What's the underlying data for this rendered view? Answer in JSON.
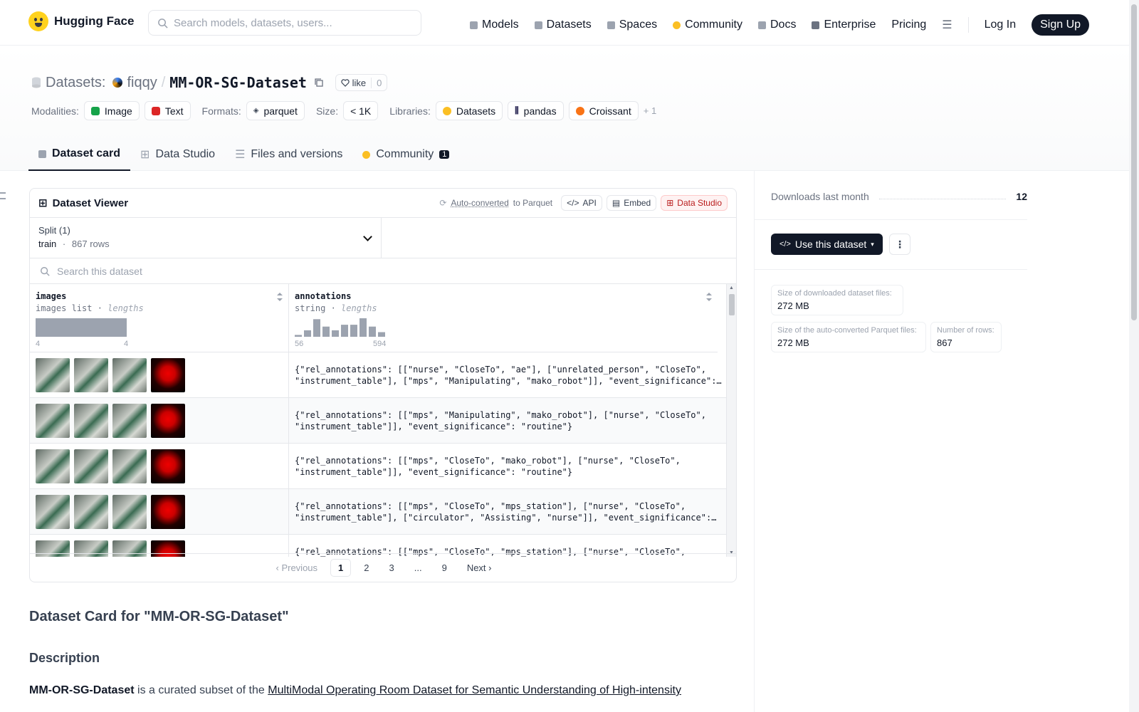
{
  "header": {
    "brand": "Hugging Face",
    "search_placeholder": "Search models, datasets, users...",
    "nav": [
      {
        "label": "Models",
        "icon": "cube-icon",
        "color": "#9ca3af"
      },
      {
        "label": "Datasets",
        "icon": "database-icon",
        "color": "#9ca3af"
      },
      {
        "label": "Spaces",
        "icon": "grid-icon",
        "color": "#9ca3af"
      },
      {
        "label": "Community",
        "icon": "community-icon",
        "color": "#fbbf24"
      },
      {
        "label": "Docs",
        "icon": "book-icon",
        "color": "#9ca3af"
      },
      {
        "label": "Enterprise",
        "icon": "enterprise-icon",
        "color": "#6b7280"
      },
      {
        "label": "Pricing",
        "icon": "",
        "color": ""
      }
    ],
    "login": "Log In",
    "signup": "Sign Up"
  },
  "repo": {
    "type_label": "Datasets:",
    "owner": "fiqqy",
    "slash": "/",
    "name": "MM-OR-SG-Dataset",
    "like_label": "like",
    "like_count": "0"
  },
  "tags": {
    "modalities_label": "Modalities:",
    "modalities": [
      "Image",
      "Text"
    ],
    "formats_label": "Formats:",
    "formats": [
      "parquet"
    ],
    "size_label": "Size:",
    "size": "< 1K",
    "libraries_label": "Libraries:",
    "libraries": [
      "Datasets",
      "pandas",
      "Croissant"
    ],
    "more": "+ 1"
  },
  "tabs": [
    {
      "label": "Dataset card",
      "active": true
    },
    {
      "label": "Data Studio",
      "active": false
    },
    {
      "label": "Files and versions",
      "active": false
    },
    {
      "label": "Community",
      "active": false,
      "count": "1"
    }
  ],
  "viewer": {
    "title": "Dataset Viewer",
    "auto_converted": "Auto-converted",
    "to_parquet": "to Parquet",
    "api": "API",
    "embed": "Embed",
    "data_studio": "Data Studio",
    "split_label": "Split (1)",
    "split_name": "train",
    "split_dot": "·",
    "split_rows": "867 rows",
    "search_placeholder": "Search this dataset",
    "columns": [
      {
        "name": "images",
        "type": "images list",
        "stat": "lengths",
        "min": "4",
        "max": "4",
        "hist": [
          1.0
        ]
      },
      {
        "name": "annotations",
        "type": "string",
        "stat": "lengths",
        "min": "56",
        "max": "594",
        "hist": [
          0.1,
          0.35,
          0.95,
          0.55,
          0.35,
          0.65,
          0.65,
          1.0,
          0.55,
          0.25
        ]
      }
    ],
    "rows": [
      {
        "text": "{\"rel_annotations\": [[\"nurse\", \"CloseTo\", \"ae\"], [\"unrelated_person\", \"CloseTo\",\n\"instrument_table\"], [\"mps\", \"Manipulating\", \"mako_robot\"]], \"event_significance\":…"
      },
      {
        "text": "{\"rel_annotations\": [[\"mps\", \"Manipulating\", \"mako_robot\"], [\"nurse\", \"CloseTo\",\n\"instrument_table\"]], \"event_significance\": \"routine\"}"
      },
      {
        "text": "{\"rel_annotations\": [[\"mps\", \"CloseTo\", \"mako_robot\"], [\"nurse\", \"CloseTo\",\n\"instrument_table\"]], \"event_significance\": \"routine\"}"
      },
      {
        "text": "{\"rel_annotations\": [[\"mps\", \"CloseTo\", \"mps_station\"], [\"nurse\", \"CloseTo\",\n\"instrument_table\"], [\"circulator\", \"Assisting\", \"nurse\"]], \"event_significance\":…"
      },
      {
        "text": "{\"rel_annotations\": [[\"mps\", \"CloseTo\", \"mps_station\"], [\"nurse\", \"CloseTo\","
      }
    ],
    "pager": {
      "prev": "Previous",
      "pages": [
        "1",
        "2",
        "3",
        "...",
        "9"
      ],
      "next": "Next",
      "current": "1"
    }
  },
  "sidebar": {
    "downloads_label": "Downloads last month",
    "downloads_value": "12",
    "use_button": "Use this dataset",
    "stats": [
      {
        "label": "Size of downloaded dataset files:",
        "value": "272 MB"
      },
      {
        "label": "Size of the auto-converted Parquet files:",
        "value": "272 MB"
      },
      {
        "label": "Number of rows:",
        "value": "867"
      }
    ]
  },
  "card": {
    "title": "Dataset Card for \"MM-OR-SG-Dataset\"",
    "description_heading": "Description",
    "desc_bold": "MM-OR-SG-Dataset",
    "desc_text": " is a curated subset of the ",
    "desc_link": "MultiModal Operating Room Dataset for Semantic Understanding of High-intensity"
  }
}
